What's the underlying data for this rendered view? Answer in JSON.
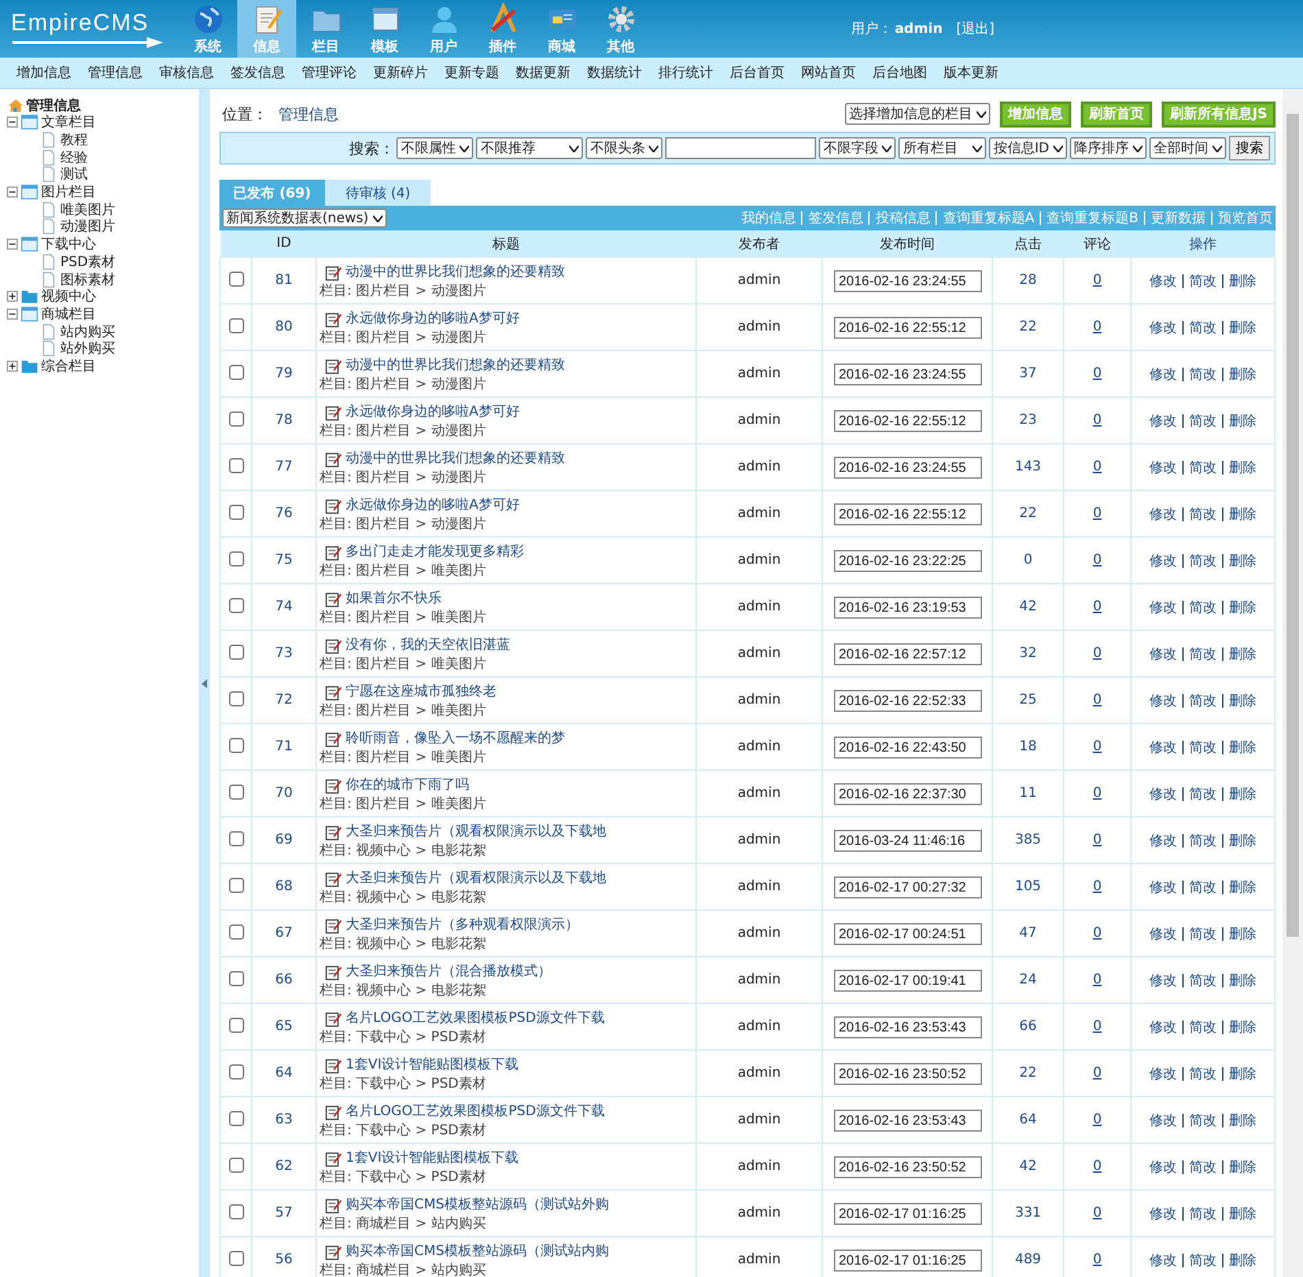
{
  "header": {
    "logo": "EmpireCMS",
    "nav": [
      {
        "label": "系统",
        "selected": false
      },
      {
        "label": "信息",
        "selected": true
      },
      {
        "label": "栏目",
        "selected": false
      },
      {
        "label": "模板",
        "selected": false
      },
      {
        "label": "用户",
        "selected": false
      },
      {
        "label": "插件",
        "selected": false
      },
      {
        "label": "商城",
        "selected": false
      },
      {
        "label": "其他",
        "selected": false
      }
    ],
    "user_label": "用户：",
    "user": "admin",
    "logout": "[退出]"
  },
  "menu": [
    "增加信息",
    "管理信息",
    "审核信息",
    "签发信息",
    "管理评论",
    "更新碎片",
    "更新专题",
    "数据更新",
    "数据统计",
    "排行统计",
    "后台首页",
    "网站首页",
    "后台地图",
    "版本更新"
  ],
  "sidebar": {
    "title": "管理信息",
    "tree": [
      {
        "label": "文章栏目",
        "expanded": true,
        "children": [
          {
            "label": "教程"
          },
          {
            "label": "经验"
          },
          {
            "label": "测试"
          }
        ]
      },
      {
        "label": "图片栏目",
        "expanded": true,
        "children": [
          {
            "label": "唯美图片"
          },
          {
            "label": "动漫图片"
          }
        ]
      },
      {
        "label": "下载中心",
        "expanded": true,
        "children": [
          {
            "label": "PSD素材"
          },
          {
            "label": "图标素材"
          }
        ]
      },
      {
        "label": "视频中心",
        "expanded": false
      },
      {
        "label": "商城栏目",
        "expanded": true,
        "children": [
          {
            "label": "站内购买"
          },
          {
            "label": "站外购买"
          }
        ]
      },
      {
        "label": "综合栏目",
        "expanded": false
      }
    ]
  },
  "location": {
    "label": "位置：",
    "link": "管理信息"
  },
  "actions": {
    "column_select": "选择增加信息的栏目",
    "buttons": [
      "增加信息",
      "刷新首页",
      "刷新所有信息JS"
    ]
  },
  "search": {
    "label": "搜索：",
    "filters_before": [
      "不限属性",
      "不限推荐",
      "不限头条"
    ],
    "filters_after": [
      "不限字段",
      "所有栏目",
      "按信息ID",
      "降序排序",
      "全部时间"
    ],
    "button": "搜索"
  },
  "tabs": [
    {
      "label": "已发布 (69)",
      "selected": true
    },
    {
      "label": "待审核 (4)",
      "selected": false
    }
  ],
  "table_select": "新闻系统数据表(news)",
  "links": [
    "我的信息",
    "签发信息",
    "投稿信息",
    "查询重复标题A",
    "查询重复标题B",
    "更新数据",
    "预览首页"
  ],
  "table": {
    "columns": [
      "ID",
      "标题",
      "发布者",
      "发布时间",
      "点击",
      "评论",
      "操作"
    ],
    "rows": [
      {
        "checked": false,
        "id": "81",
        "title": "动漫中的世界比我们想象的还要精致",
        "category": "栏目: 图片栏目 > 动漫图片",
        "author": "admin",
        "time": "2016-02-16 23:24:55",
        "clicks": "28",
        "comments": "0",
        "actions": [
          "修改",
          "简改",
          "删除"
        ]
      },
      {
        "checked": false,
        "id": "80",
        "title": "永远做你身边的哆啦A梦可好",
        "category": "栏目: 图片栏目 > 动漫图片",
        "author": "admin",
        "time": "2016-02-16 22:55:12",
        "clicks": "22",
        "comments": "0",
        "actions": [
          "修改",
          "简改",
          "删除"
        ]
      },
      {
        "checked": false,
        "id": "79",
        "title": "动漫中的世界比我们想象的还要精致",
        "category": "栏目: 图片栏目 > 动漫图片",
        "author": "admin",
        "time": "2016-02-16 23:24:55",
        "clicks": "37",
        "comments": "0",
        "actions": [
          "修改",
          "简改",
          "删除"
        ]
      },
      {
        "checked": false,
        "id": "78",
        "title": "永远做你身边的哆啦A梦可好",
        "category": "栏目: 图片栏目 > 动漫图片",
        "author": "admin",
        "time": "2016-02-16 22:55:12",
        "clicks": "23",
        "comments": "0",
        "actions": [
          "修改",
          "简改",
          "删除"
        ]
      },
      {
        "checked": false,
        "id": "77",
        "title": "动漫中的世界比我们想象的还要精致",
        "category": "栏目: 图片栏目 > 动漫图片",
        "author": "admin",
        "time": "2016-02-16 23:24:55",
        "clicks": "143",
        "comments": "0",
        "actions": [
          "修改",
          "简改",
          "删除"
        ]
      },
      {
        "checked": false,
        "id": "76",
        "title": "永远做你身边的哆啦A梦可好",
        "category": "栏目: 图片栏目 > 动漫图片",
        "author": "admin",
        "time": "2016-02-16 22:55:12",
        "clicks": "22",
        "comments": "0",
        "actions": [
          "修改",
          "简改",
          "删除"
        ]
      },
      {
        "checked": false,
        "id": "75",
        "title": "多出门走走才能发现更多精彩",
        "category": "栏目: 图片栏目 > 唯美图片",
        "author": "admin",
        "time": "2016-02-16 23:22:25",
        "clicks": "0",
        "comments": "0",
        "actions": [
          "修改",
          "简改",
          "删除"
        ]
      },
      {
        "checked": false,
        "id": "74",
        "title": "如果首尔不快乐",
        "category": "栏目: 图片栏目 > 唯美图片",
        "author": "admin",
        "time": "2016-02-16 23:19:53",
        "clicks": "42",
        "comments": "0",
        "actions": [
          "修改",
          "简改",
          "删除"
        ]
      },
      {
        "checked": false,
        "id": "73",
        "title": "没有你，我的天空依旧湛蓝",
        "category": "栏目: 图片栏目 > 唯美图片",
        "author": "admin",
        "time": "2016-02-16 22:57:12",
        "clicks": "32",
        "comments": "0",
        "actions": [
          "修改",
          "简改",
          "删除"
        ]
      },
      {
        "checked": false,
        "id": "72",
        "title": "宁愿在这座城市孤独终老",
        "category": "栏目: 图片栏目 > 唯美图片",
        "author": "admin",
        "time": "2016-02-16 22:52:33",
        "clicks": "25",
        "comments": "0",
        "actions": [
          "修改",
          "简改",
          "删除"
        ]
      },
      {
        "checked": false,
        "id": "71",
        "title": "聆听雨音，像坠入一场不愿醒来的梦",
        "category": "栏目: 图片栏目 > 唯美图片",
        "author": "admin",
        "time": "2016-02-16 22:43:50",
        "clicks": "18",
        "comments": "0",
        "actions": [
          "修改",
          "简改",
          "删除"
        ]
      },
      {
        "checked": false,
        "id": "70",
        "title": "你在的城市下雨了吗",
        "category": "栏目: 图片栏目 > 唯美图片",
        "author": "admin",
        "time": "2016-02-16 22:37:30",
        "clicks": "11",
        "comments": "0",
        "actions": [
          "修改",
          "简改",
          "删除"
        ]
      },
      {
        "checked": false,
        "id": "69",
        "title": "大圣归来预告片（观看权限演示以及下载地",
        "category": "栏目: 视频中心 > 电影花絮",
        "author": "admin",
        "time": "2016-03-24 11:46:16",
        "clicks": "385",
        "comments": "0",
        "actions": [
          "修改",
          "简改",
          "删除"
        ]
      },
      {
        "checked": false,
        "id": "68",
        "title": "大圣归来预告片（观看权限演示以及下载地",
        "category": "栏目: 视频中心 > 电影花絮",
        "author": "admin",
        "time": "2016-02-17 00:27:32",
        "clicks": "105",
        "comments": "0",
        "actions": [
          "修改",
          "简改",
          "删除"
        ]
      },
      {
        "checked": false,
        "id": "67",
        "title": "大圣归来预告片（多种观看权限演示）",
        "category": "栏目: 视频中心 > 电影花絮",
        "author": "admin",
        "time": "2016-02-17 00:24:51",
        "clicks": "47",
        "comments": "0",
        "actions": [
          "修改",
          "简改",
          "删除"
        ]
      },
      {
        "checked": false,
        "id": "66",
        "title": "大圣归来预告片（混合播放模式）",
        "category": "栏目: 视频中心 > 电影花絮",
        "author": "admin",
        "time": "2016-02-17 00:19:41",
        "clicks": "24",
        "comments": "0",
        "actions": [
          "修改",
          "简改",
          "删除"
        ]
      },
      {
        "checked": false,
        "id": "65",
        "title": "名片LOGO工艺效果图模板PSD源文件下载",
        "category": "栏目: 下载中心 > PSD素材",
        "author": "admin",
        "time": "2016-02-16 23:53:43",
        "clicks": "66",
        "comments": "0",
        "actions": [
          "修改",
          "简改",
          "删除"
        ]
      },
      {
        "checked": false,
        "id": "64",
        "title": "1套VI设计智能贴图模板下载",
        "category": "栏目: 下载中心 > PSD素材",
        "author": "admin",
        "time": "2016-02-16 23:50:52",
        "clicks": "22",
        "comments": "0",
        "actions": [
          "修改",
          "简改",
          "删除"
        ]
      },
      {
        "checked": false,
        "id": "63",
        "title": "名片LOGO工艺效果图模板PSD源文件下载",
        "category": "栏目: 下载中心 > PSD素材",
        "author": "admin",
        "time": "2016-02-16 23:53:43",
        "clicks": "64",
        "comments": "0",
        "actions": [
          "修改",
          "简改",
          "删除"
        ]
      },
      {
        "checked": false,
        "id": "62",
        "title": "1套VI设计智能贴图模板下载",
        "category": "栏目: 下载中心 > PSD素材",
        "author": "admin",
        "time": "2016-02-16 23:50:52",
        "clicks": "42",
        "comments": "0",
        "actions": [
          "修改",
          "简改",
          "删除"
        ]
      },
      {
        "checked": false,
        "id": "57",
        "title": "购买本帝国CMS模板整站源码（测试站外购",
        "category": "栏目: 商城栏目 > 站内购买",
        "author": "admin",
        "time": "2016-02-17 01:16:25",
        "clicks": "331",
        "comments": "0",
        "actions": [
          "修改",
          "简改",
          "删除"
        ]
      },
      {
        "checked": false,
        "id": "56",
        "title": "购买本帝国CMS模板整站源码（测试站内购",
        "category": "栏目: 商城栏目 > 站内购买",
        "author": "admin",
        "time": "2016-02-17 01:16:25",
        "clicks": "489",
        "comments": "0",
        "actions": [
          "修改",
          "简改",
          "删除"
        ]
      }
    ]
  }
}
